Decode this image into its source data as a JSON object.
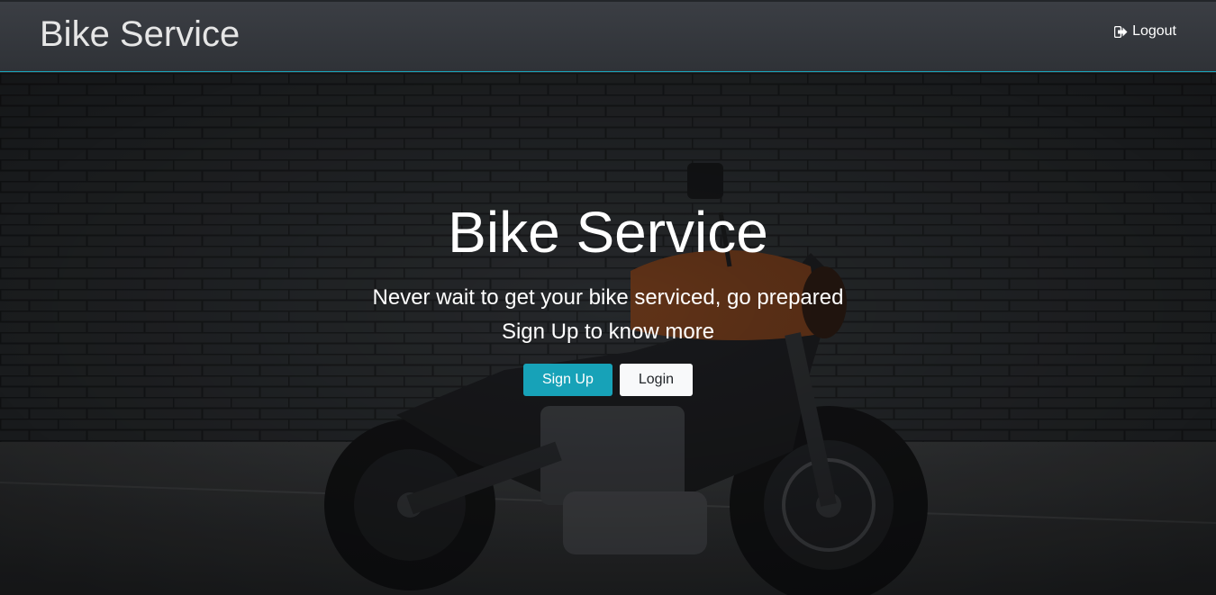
{
  "navbar": {
    "brand": "Bike Service",
    "logout_label": "Logout",
    "logout_icon": "sign-out-icon"
  },
  "hero": {
    "title": "Bike Service",
    "tagline": "Never wait to get your bike serviced, go prepared",
    "subtext": "Sign Up to know more",
    "signup_label": "Sign Up",
    "login_label": "Login",
    "background_image": "motorcycle-against-brick-wall"
  },
  "colors": {
    "accent": "#17a2b8",
    "navbar_bg": "#34373c",
    "light_button": "#f8f9fa"
  }
}
